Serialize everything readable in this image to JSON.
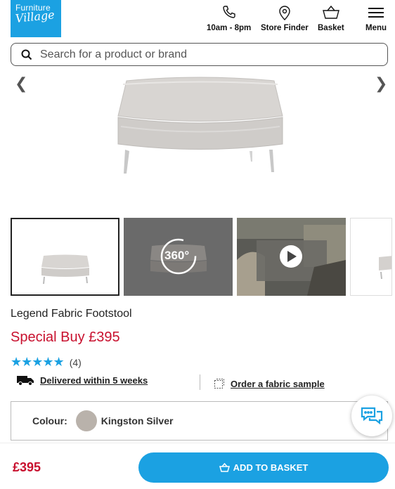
{
  "header": {
    "logo_line1": "Furniture",
    "logo_line2": "Village",
    "nav": [
      {
        "label": "10am - 8pm",
        "icon": "phone-icon"
      },
      {
        "label": "Store Finder",
        "icon": "location-pin-icon"
      },
      {
        "label": "Basket",
        "icon": "basket-icon"
      },
      {
        "label": "Menu",
        "icon": "hamburger-icon"
      }
    ]
  },
  "search": {
    "placeholder": "Search for a product or brand"
  },
  "gallery": {
    "prev_arrow": "❮",
    "next_arrow": "❯",
    "thumb_360_label": "360°"
  },
  "product": {
    "title": "Legend Fabric Footstool",
    "price_label": "Special Buy £395",
    "rating_stars": "★★★★★",
    "rating_value": 4.5,
    "review_count": "(4)",
    "delivery_text": "Delivered within 5 weeks",
    "sample_text": "Order a fabric sample",
    "colour_label": "Colour:",
    "colour_value": "Kingston Silver",
    "swatch_color": "#b9b2ab"
  },
  "bottom_bar": {
    "price": "£395",
    "add_button": "ADD TO BASKET"
  },
  "colors": {
    "brand_blue": "#1ba1e2",
    "price_red": "#c8102e"
  }
}
